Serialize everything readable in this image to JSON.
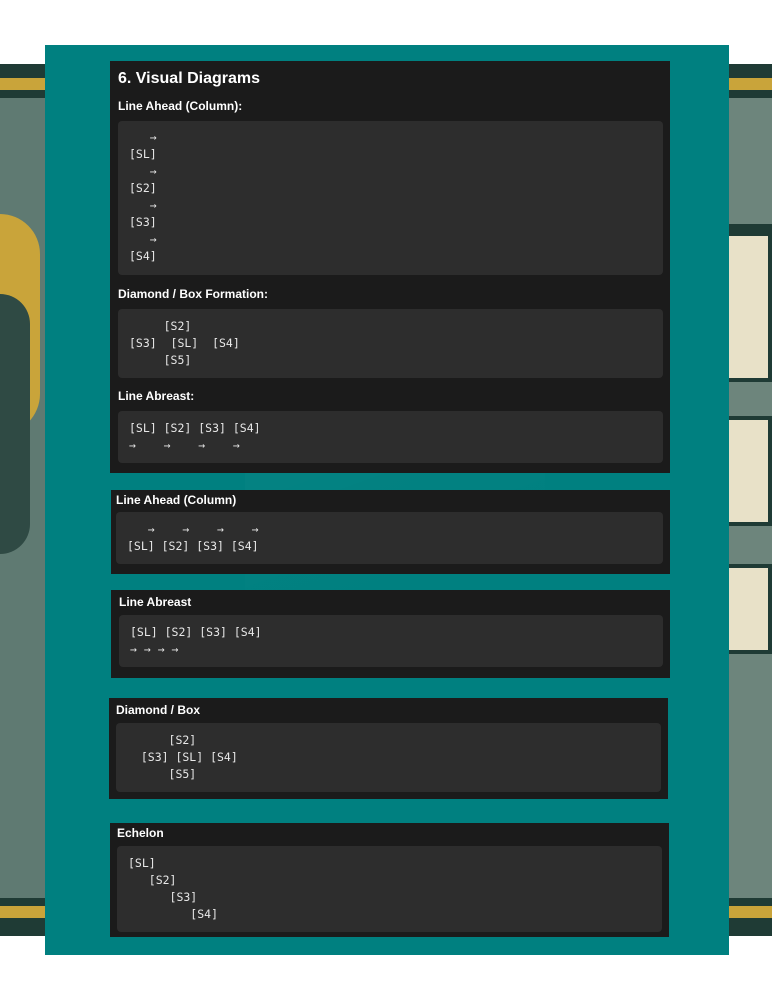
{
  "main_section": {
    "title": "6. Visual Diagrams",
    "line_ahead_heading": "Line Ahead (Column):",
    "line_ahead_diagram": "   →\n[SL]\n   →\n[S2]\n   →\n[S3]\n   →\n[S4]",
    "diamond_heading": "Diamond / Box Formation:",
    "diamond_diagram": "     [S2]\n[S3]  [SL]  [S4]\n     [S5]",
    "line_abreast_heading": "Line Abreast:",
    "line_abreast_diagram": "[SL] [S2] [S3] [S4]\n→    →    →    →"
  },
  "cards": [
    {
      "title": "Line Ahead (Column)",
      "diagram": "   →    →    →    →\n[SL] [S2] [S3] [S4]"
    },
    {
      "title": "Line Abreast",
      "diagram": "[SL] [S2] [S3] [S4]\n→ → → →"
    },
    {
      "title": "Diamond / Box",
      "diagram": "      [S2]\n  [S3] [SL] [S4]\n      [S5]"
    },
    {
      "title": "Echelon",
      "diagram": "[SL]\n   [S2]\n      [S3]\n         [S4]"
    }
  ],
  "colors": {
    "panel": "#008080",
    "card": "#1b1b1b",
    "code_block": "#2d2d2d"
  }
}
